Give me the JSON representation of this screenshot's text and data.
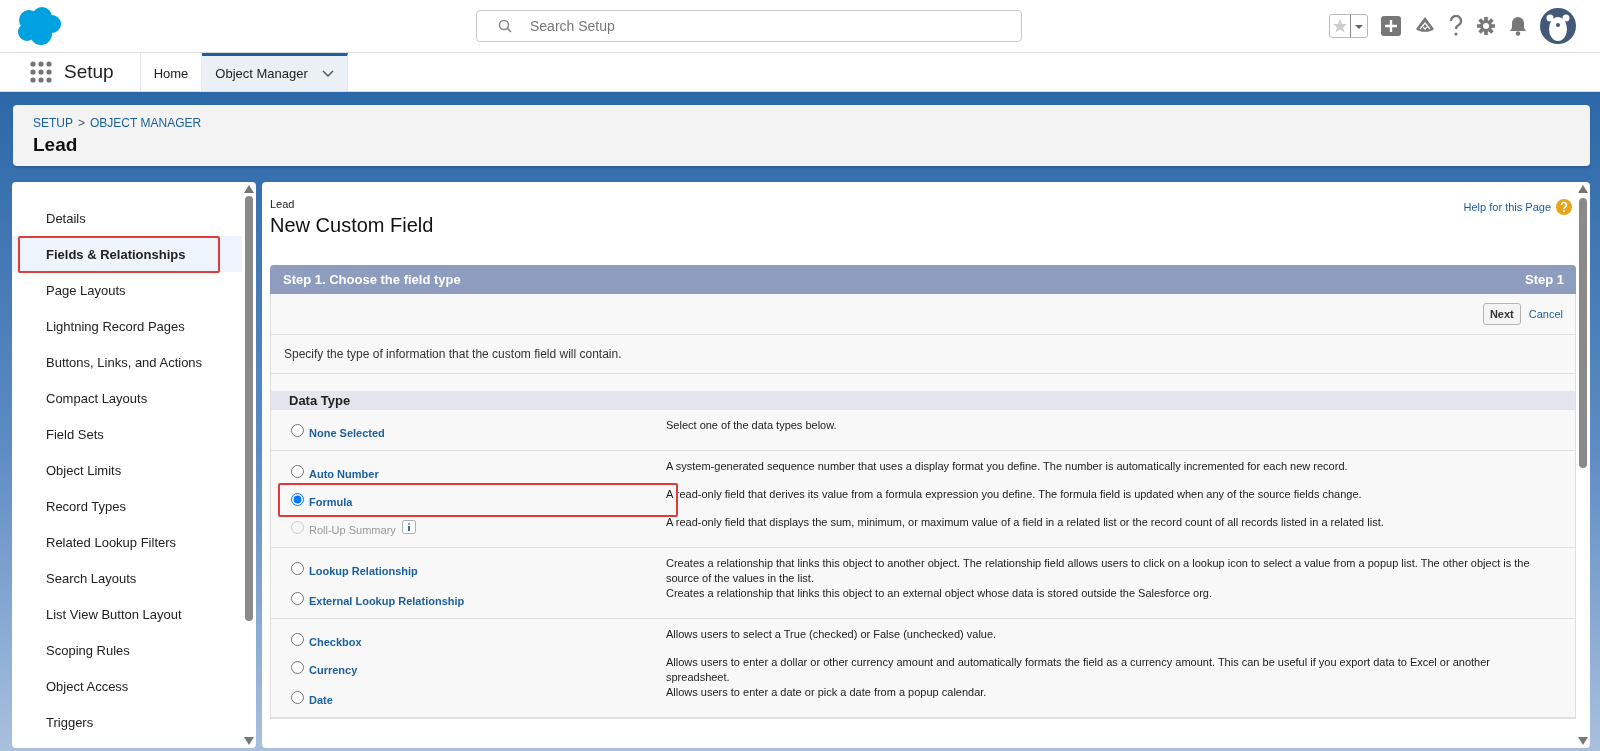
{
  "header": {
    "search": {
      "placeholder": "Search Setup"
    }
  },
  "nav": {
    "app_name": "Setup",
    "tabs": [
      {
        "label": "Home",
        "selected": false,
        "has_menu": false
      },
      {
        "label": "Object Manager",
        "selected": true,
        "has_menu": true
      }
    ]
  },
  "breadcrumb": {
    "path": [
      "SETUP",
      "OBJECT MANAGER"
    ],
    "separator": ">",
    "title": "Lead"
  },
  "sidebar": {
    "items": [
      {
        "label": "Details",
        "selected": false,
        "highlighted": false
      },
      {
        "label": "Fields & Relationships",
        "selected": true,
        "highlighted": true
      },
      {
        "label": "Page Layouts",
        "selected": false,
        "highlighted": false
      },
      {
        "label": "Lightning Record Pages",
        "selected": false,
        "highlighted": false
      },
      {
        "label": "Buttons, Links, and Actions",
        "selected": false,
        "highlighted": false
      },
      {
        "label": "Compact Layouts",
        "selected": false,
        "highlighted": false
      },
      {
        "label": "Field Sets",
        "selected": false,
        "highlighted": false
      },
      {
        "label": "Object Limits",
        "selected": false,
        "highlighted": false
      },
      {
        "label": "Record Types",
        "selected": false,
        "highlighted": false
      },
      {
        "label": "Related Lookup Filters",
        "selected": false,
        "highlighted": false
      },
      {
        "label": "Search Layouts",
        "selected": false,
        "highlighted": false
      },
      {
        "label": "List View Button Layout",
        "selected": false,
        "highlighted": false
      },
      {
        "label": "Scoping Rules",
        "selected": false,
        "highlighted": false
      },
      {
        "label": "Object Access",
        "selected": false,
        "highlighted": false
      },
      {
        "label": "Triggers",
        "selected": false,
        "highlighted": false
      }
    ]
  },
  "content": {
    "object_label": "Lead",
    "title": "New Custom Field",
    "help_link": "Help for this Page",
    "step": {
      "title": "Step 1. Choose the field type",
      "number": "Step 1"
    },
    "buttons": [
      {
        "label": "Next",
        "kind": "button"
      },
      {
        "label": "Cancel",
        "kind": "link"
      }
    ],
    "instructions": "Specify the type of information that the custom field will contain.",
    "section_title": "Data Type",
    "groups": [
      {
        "types": [
          {
            "label": "None Selected",
            "description": "Select one of the data types below.",
            "selected": false,
            "disabled": false,
            "highlighted": false,
            "info": false
          }
        ]
      },
      {
        "types": [
          {
            "label": "Auto Number",
            "description": "A system-generated sequence number that uses a display format you define. The number is automatically incremented for each new record.",
            "selected": false,
            "disabled": false,
            "highlighted": false,
            "info": false
          },
          {
            "label": "Formula",
            "description": "A read-only field that derives its value from a formula expression you define. The formula field is updated when any of the source fields change.",
            "selected": true,
            "disabled": false,
            "highlighted": true,
            "info": false
          },
          {
            "label": "Roll-Up Summary",
            "description": "A read-only field that displays the sum, minimum, or maximum value of a field in a related list or the record count of all records listed in a related list.",
            "selected": false,
            "disabled": true,
            "highlighted": false,
            "info": true
          }
        ]
      },
      {
        "types": [
          {
            "label": "Lookup Relationship",
            "description": "Creates a relationship that links this object to another object. The relationship field allows users to click on a lookup icon to select a value from a popup list. The other object is the source of the values in the list.",
            "selected": false,
            "disabled": false,
            "highlighted": false,
            "info": false
          },
          {
            "label": "External Lookup Relationship",
            "description": "Creates a relationship that links this object to an external object whose data is stored outside the Salesforce org.",
            "selected": false,
            "disabled": false,
            "highlighted": false,
            "info": false
          }
        ]
      },
      {
        "types": [
          {
            "label": "Checkbox",
            "description": "Allows users to select a True (checked) or False (unchecked) value.",
            "selected": false,
            "disabled": false,
            "highlighted": false,
            "info": false
          },
          {
            "label": "Currency",
            "description": "Allows users to enter a dollar or other currency amount and automatically formats the field as a currency amount. This can be useful if you export data to Excel or another spreadsheet.",
            "selected": false,
            "disabled": false,
            "highlighted": false,
            "info": false
          },
          {
            "label": "Date",
            "description": "Allows users to enter a date or pick a date from a popup calendar.",
            "selected": false,
            "disabled": false,
            "highlighted": false,
            "info": false
          }
        ]
      }
    ]
  }
}
